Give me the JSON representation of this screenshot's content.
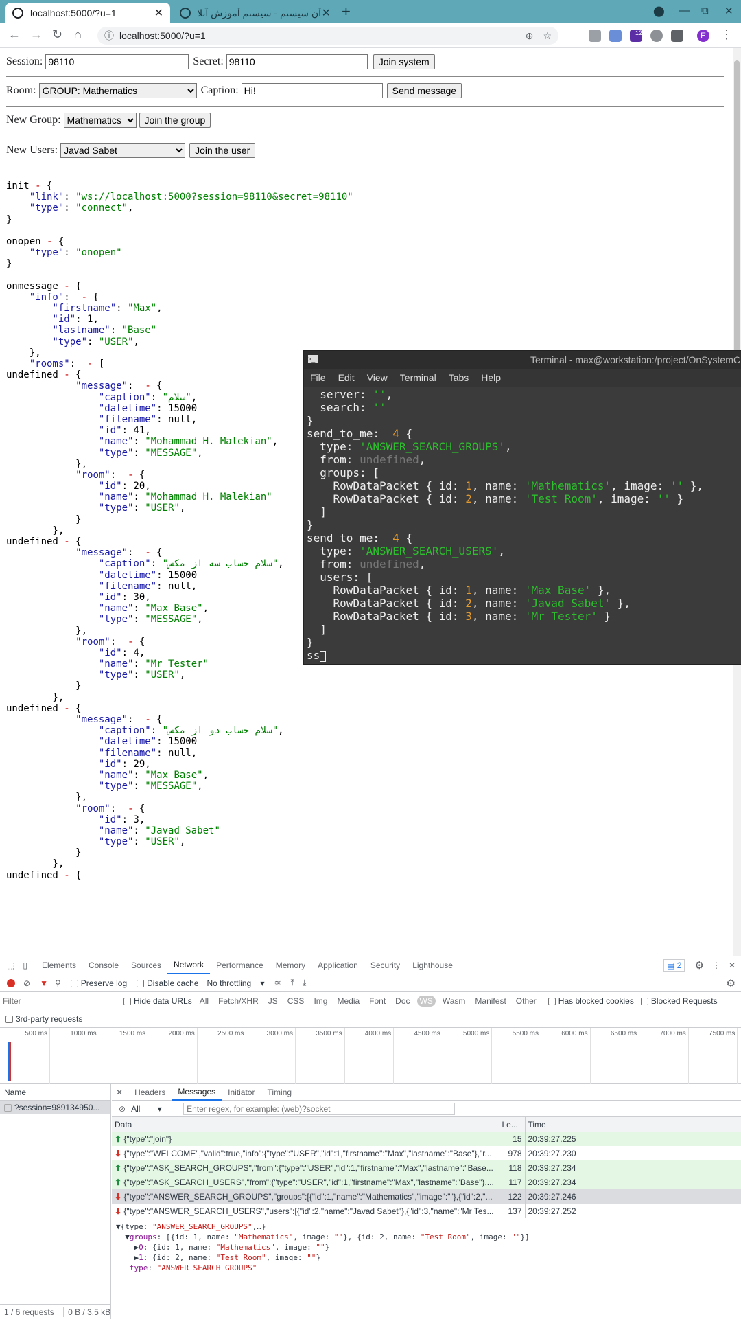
{
  "browser": {
    "tabs": [
      {
        "title": "localhost:5000/?u=1"
      },
      {
        "title": "آن سیستم - سیستم آموزش آنلاین"
      }
    ],
    "url": "localhost:5000/?u=1",
    "ext_badge": "12",
    "profile_initial": "E"
  },
  "form": {
    "session_label": "Session:",
    "session_value": "98110",
    "secret_label": "Secret:",
    "secret_value": "98110",
    "join_system": "Join system",
    "room_label": "Room:",
    "room_value": "GROUP: Mathematics",
    "caption_label": "Caption:",
    "caption_value": "Hi!",
    "send_message": "Send message",
    "new_group_label": "New Group:",
    "new_group_value": "Mathematics",
    "join_group": "Join the group",
    "new_users_label": "New Users:",
    "new_users_value": "Javad Sabet",
    "join_user": "Join the user"
  },
  "log_lines": [
    "init - {",
    "    \"link\": \"ws://localhost:5000?session=98110&secret=98110\"",
    "    \"type\": \"connect\",",
    "}",
    "",
    "onopen - {",
    "    \"type\": \"onopen\"",
    "}",
    "",
    "onmessage - {",
    "    \"info\":  - {",
    "        \"firstname\": \"Max\",",
    "        \"id\": 1,",
    "        \"lastname\": \"Base\"",
    "        \"type\": \"USER\",",
    "    },",
    "    \"rooms\":  - [",
    "undefined - {",
    "            \"message\":  - {",
    "                \"caption\": \"سلام\",",
    "                \"datetime\": 15000",
    "                \"filename\": null,",
    "                \"id\": 41,",
    "                \"name\": \"Mohammad H. Malekian\",",
    "                \"type\": \"MESSAGE\",",
    "            },",
    "            \"room\":  - {",
    "                \"id\": 20,",
    "                \"name\": \"Mohammad H. Malekian\"",
    "                \"type\": \"USER\",",
    "            }",
    "        },",
    "undefined - {",
    "            \"message\":  - {",
    "                \"caption\": \"سلام حساب سه از مکس\",",
    "                \"datetime\": 15000",
    "                \"filename\": null,",
    "                \"id\": 30,",
    "                \"name\": \"Max Base\",",
    "                \"type\": \"MESSAGE\",",
    "            },",
    "            \"room\":  - {",
    "                \"id\": 4,",
    "                \"name\": \"Mr Tester\"",
    "                \"type\": \"USER\",",
    "            }",
    "        },",
    "undefined - {",
    "            \"message\":  - {",
    "                \"caption\": \"سلام حساب دو از مکس\",",
    "                \"datetime\": 15000",
    "                \"filename\": null,",
    "                \"id\": 29,",
    "                \"name\": \"Max Base\",",
    "                \"type\": \"MESSAGE\",",
    "            },",
    "            \"room\":  - {",
    "                \"id\": 3,",
    "                \"name\": \"Javad Sabet\"",
    "                \"type\": \"USER\",",
    "            }",
    "        },",
    "undefined - {"
  ],
  "terminal": {
    "title": "Terminal - max@workstation:/project/OnSystemC",
    "menu": [
      "File",
      "Edit",
      "View",
      "Terminal",
      "Tabs",
      "Help"
    ],
    "lines": [
      "  server: '',",
      "  search: ''",
      "}",
      "send_to_me:  4 {",
      "  type: 'ANSWER_SEARCH_GROUPS',",
      "  from: undefined,",
      "  groups: [",
      "    RowDataPacket { id: 1, name: 'Mathematics', image: '' },",
      "    RowDataPacket { id: 2, name: 'Test Room', image: '' }",
      "  ]",
      "}",
      "send_to_me:  4 {",
      "  type: 'ANSWER_SEARCH_USERS',",
      "  from: undefined,",
      "  users: [",
      "    RowDataPacket { id: 1, name: 'Max Base' },",
      "    RowDataPacket { id: 2, name: 'Javad Sabet' },",
      "    RowDataPacket { id: 3, name: 'Mr Tester' }",
      "  ]",
      "}",
      "ss"
    ]
  },
  "devtools": {
    "tabs": [
      "Elements",
      "Console",
      "Sources",
      "Network",
      "Performance",
      "Memory",
      "Application",
      "Security",
      "Lighthouse"
    ],
    "selected_tab": "Network",
    "issues_count": "2",
    "preserve_log": "Preserve log",
    "disable_cache": "Disable cache",
    "throttling": "No throttling",
    "filter_placeholder": "Filter",
    "hide_data_urls": "Hide data URLs",
    "filter_chips": [
      "All",
      "Fetch/XHR",
      "JS",
      "CSS",
      "Img",
      "Media",
      "Font",
      "Doc",
      "WS",
      "Wasm",
      "Manifest",
      "Other"
    ],
    "has_blocked_cookies": "Has blocked cookies",
    "blocked_requests": "Blocked Requests",
    "third_party": "3rd-party requests",
    "timeline_ticks": [
      "500 ms",
      "1000 ms",
      "1500 ms",
      "2000 ms",
      "2500 ms",
      "3000 ms",
      "3500 ms",
      "4000 ms",
      "4500 ms",
      "5000 ms",
      "5500 ms",
      "6000 ms",
      "6500 ms",
      "7000 ms",
      "7500 ms"
    ],
    "name_header": "Name",
    "request_name": "?session=989134950...",
    "detail_tabs": [
      "Headers",
      "Messages",
      "Initiator",
      "Timing"
    ],
    "selected_detail_tab": "Messages",
    "msg_filter_all": "All",
    "msg_filter_placeholder": "Enter regex, for example: (web)?socket",
    "col_data": "Data",
    "col_length": "Le...",
    "col_time": "Time",
    "messages": [
      {
        "dir": "up",
        "data": "{\"type\":\"join\"}",
        "length": "15",
        "time": "20:39:27.225"
      },
      {
        "dir": "down",
        "data": "{\"type\":\"WELCOME\",\"valid\":true,\"info\":{\"type\":\"USER\",\"id\":1,\"firstname\":\"Max\",\"lastname\":\"Base\"},\"r...",
        "length": "978",
        "time": "20:39:27.230"
      },
      {
        "dir": "up",
        "data": "{\"type\":\"ASK_SEARCH_GROUPS\",\"from\":{\"type\":\"USER\",\"id\":1,\"firstname\":\"Max\",\"lastname\":\"Base...",
        "length": "118",
        "time": "20:39:27.234"
      },
      {
        "dir": "up",
        "data": "{\"type\":\"ASK_SEARCH_USERS\",\"from\":{\"type\":\"USER\",\"id\":1,\"firstname\":\"Max\",\"lastname\":\"Base\"},...",
        "length": "117",
        "time": "20:39:27.234"
      },
      {
        "dir": "down",
        "data": "{\"type\":\"ANSWER_SEARCH_GROUPS\",\"groups\":[{\"id\":1,\"name\":\"Mathematics\",\"image\":\"\"},{\"id\":2,\"...",
        "length": "122",
        "time": "20:39:27.246",
        "selected": true
      },
      {
        "dir": "down",
        "data": "{\"type\":\"ANSWER_SEARCH_USERS\",\"users\":[{\"id\":2,\"name\":\"Javad Sabet\"},{\"id\":3,\"name\":\"Mr Tes...",
        "length": "137",
        "time": "20:39:27.252"
      }
    ],
    "detail_lines": [
      "▼{type: \"ANSWER_SEARCH_GROUPS\",…}",
      "  ▼groups: [{id: 1, name: \"Mathematics\", image: \"\"}, {id: 2, name: \"Test Room\", image: \"\"}]",
      "    ▶0: {id: 1, name: \"Mathematics\", image: \"\"}",
      "    ▶1: {id: 2, name: \"Test Room\", image: \"\"}",
      "   type: \"ANSWER_SEARCH_GROUPS\""
    ],
    "status": "1 / 6 requests",
    "transfer": "0 B / 3.5 kB"
  }
}
